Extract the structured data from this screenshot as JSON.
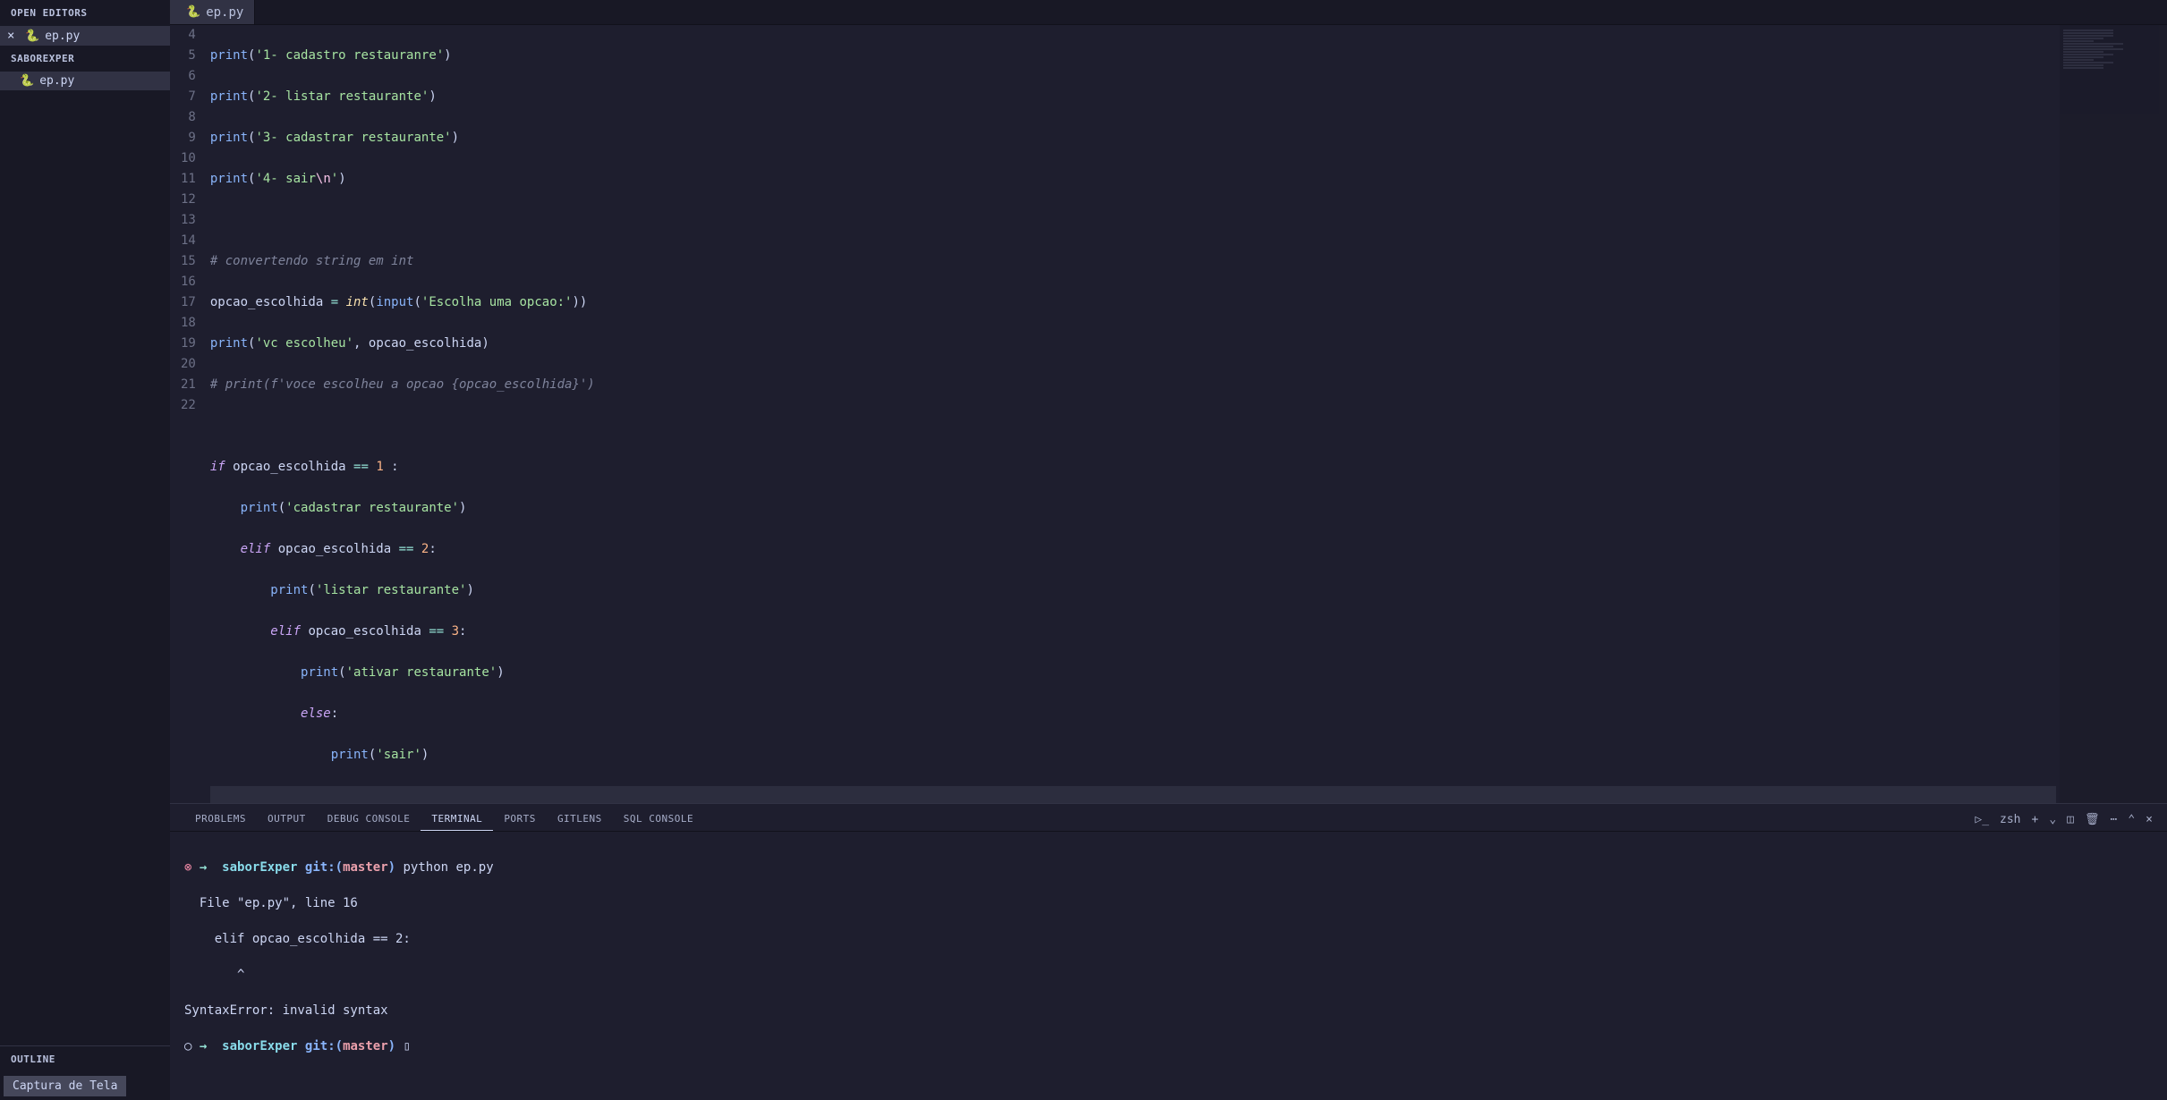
{
  "sidebar": {
    "open_editors": "OPEN EDITORS",
    "project": "SABOREXPER",
    "file": "ep.py",
    "outline": "OUTLINE",
    "captura": "Captura de Tela"
  },
  "tab": {
    "label": "ep.py"
  },
  "code": {
    "lines": [
      "4",
      "5",
      "6",
      "7",
      "8",
      "9",
      "10",
      "11",
      "12",
      "13",
      "14",
      "15",
      "16",
      "17",
      "18",
      "19",
      "20",
      "21",
      "22"
    ],
    "l4": {
      "fn": "print",
      "paren_o": "(",
      "str": "'1- cadastro restauranre'",
      "paren_c": ")"
    },
    "l5": {
      "fn": "print",
      "paren_o": "(",
      "str": "'2- listar restaurante'",
      "paren_c": ")"
    },
    "l6": {
      "fn": "print",
      "paren_o": "(",
      "str": "'3- cadastrar restaurante'",
      "paren_c": ")"
    },
    "l7": {
      "fn": "print",
      "paren_o": "(",
      "str_a": "'4- sair",
      "esc": "\\n",
      "str_b": "'",
      "paren_c": ")"
    },
    "l9": {
      "cmt": "# convertendo string em int"
    },
    "l10": {
      "var": "opcao_escolhida ",
      "op": "= ",
      "type": "int",
      "p1": "(",
      "fn": "input",
      "p2": "(",
      "str": "'Escolha uma opcao:'",
      "p3": ")",
      "p4": ")"
    },
    "l11": {
      "fn": "print",
      "p1": "(",
      "str": "'vc escolheu'",
      "comma": ", opcao_escolhida",
      "p2": ")"
    },
    "l12": {
      "cmt": "# print(f'voce escolheu a opcao {opcao_escolhida}')"
    },
    "l14": {
      "kw": "if",
      "rest": " opcao_escolhida ",
      "op": "== ",
      "num": "1",
      "colon": " :"
    },
    "l15": {
      "fn": "print",
      "p1": "(",
      "str": "'cadastrar restaurante'",
      "p2": ")"
    },
    "l16": {
      "kw": "elif",
      "rest": " opcao_escolhida ",
      "op": "== ",
      "num": "2",
      "colon": ":"
    },
    "l17": {
      "fn": "print",
      "p1": "(",
      "str": "'listar restaurante'",
      "p2": ")"
    },
    "l18": {
      "kw": "elif",
      "rest": " opcao_escolhida ",
      "op": "== ",
      "num": "3",
      "colon": ":"
    },
    "l19": {
      "fn": "print",
      "p1": "(",
      "str": "'ativar restaurante'",
      "p2": ")"
    },
    "l20": {
      "kw": "else",
      "colon": ":"
    },
    "l21": {
      "fn": "print",
      "p1": "(",
      "str": "'sair'",
      "p2": ")"
    }
  },
  "panel": {
    "tabs": {
      "problems": "PROBLEMS",
      "output": "OUTPUT",
      "debug": "DEBUG CONSOLE",
      "terminal": "TERMINAL",
      "ports": "PORTS",
      "gitlens": "GITLENS",
      "sql": "SQL CONSOLE"
    },
    "shell": "zsh"
  },
  "terminal": {
    "l1": {
      "err": "⊗",
      "arrow": "→",
      "dir": "saborExper",
      "git": "git:(",
      "branch": "master",
      "close": ")",
      "cmd": " python ep.py"
    },
    "l2": "  File \"ep.py\", line 16",
    "l3": "    elif opcao_escolhida == 2:",
    "l4": "       ^",
    "l5": "SyntaxError: invalid syntax",
    "l6": {
      "err": "○",
      "arrow": "→",
      "dir": "saborExper",
      "git": "git:(",
      "branch": "master",
      "close": ")",
      "cursor": " ▯"
    }
  }
}
